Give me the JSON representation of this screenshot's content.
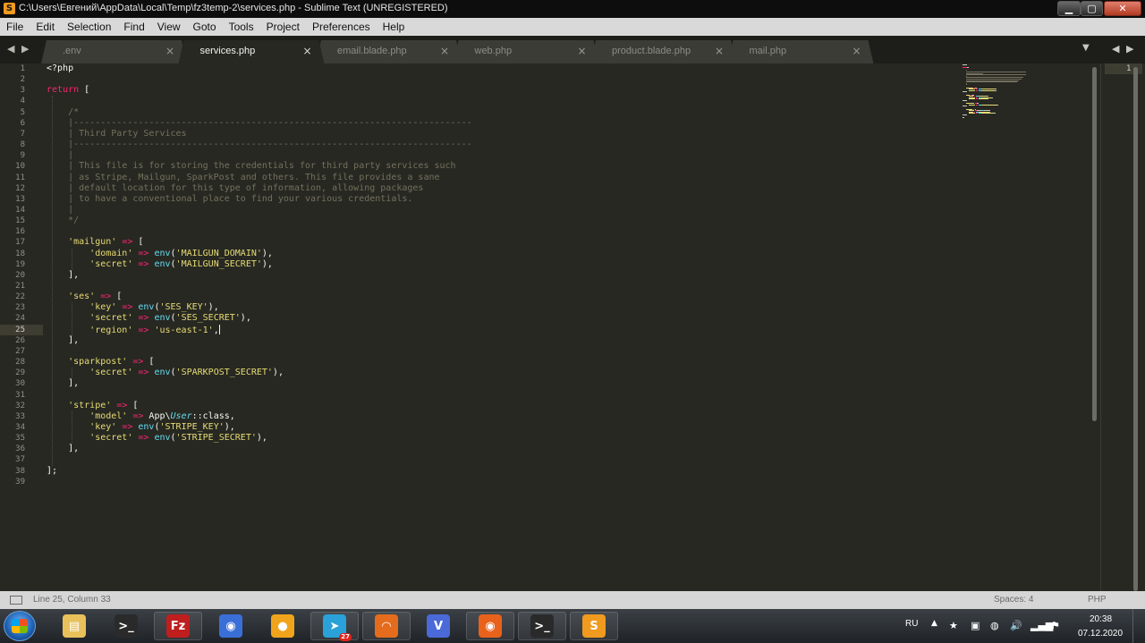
{
  "window": {
    "title": "C:\\Users\\Евгений\\AppData\\Local\\Temp\\fz3temp-2\\services.php - Sublime Text (UNREGISTERED)",
    "buttons": {
      "minimize": "▁",
      "maximize": "▢",
      "close": "✕"
    }
  },
  "menu": [
    "File",
    "Edit",
    "Selection",
    "Find",
    "View",
    "Goto",
    "Tools",
    "Project",
    "Preferences",
    "Help"
  ],
  "tabs": [
    {
      "label": ".env",
      "active": false
    },
    {
      "label": "services.php",
      "active": true
    },
    {
      "label": "email.blade.php",
      "active": false
    },
    {
      "label": "web.php",
      "active": false
    },
    {
      "label": "product.blade.php",
      "active": false
    },
    {
      "label": "mail.php",
      "active": false
    }
  ],
  "tab_close_glyph": "×",
  "tab_nav_glyph": "◀ ▶",
  "tab_dropdown_glyph": "▼",
  "code": [
    [
      [
        "",
        "<?php"
      ]
    ],
    [],
    [
      [
        "kw",
        "return"
      ],
      [
        "",
        " ["
      ]
    ],
    [],
    [
      [
        "",
        "    "
      ],
      [
        "cm",
        "/*"
      ]
    ],
    [
      [
        "",
        "    "
      ],
      [
        "cm",
        "|--------------------------------------------------------------------------"
      ]
    ],
    [
      [
        "",
        "    "
      ],
      [
        "cm",
        "| Third Party Services"
      ]
    ],
    [
      [
        "",
        "    "
      ],
      [
        "cm",
        "|--------------------------------------------------------------------------"
      ]
    ],
    [
      [
        "",
        "    "
      ],
      [
        "cm",
        "|"
      ]
    ],
    [
      [
        "",
        "    "
      ],
      [
        "cm",
        "| This file is for storing the credentials for third party services such"
      ]
    ],
    [
      [
        "",
        "    "
      ],
      [
        "cm",
        "| as Stripe, Mailgun, SparkPost and others. This file provides a sane"
      ]
    ],
    [
      [
        "",
        "    "
      ],
      [
        "cm",
        "| default location for this type of information, allowing packages"
      ]
    ],
    [
      [
        "",
        "    "
      ],
      [
        "cm",
        "| to have a conventional place to find your various credentials."
      ]
    ],
    [
      [
        "",
        "    "
      ],
      [
        "cm",
        "|"
      ]
    ],
    [
      [
        "",
        "    "
      ],
      [
        "cm",
        "*/"
      ]
    ],
    [],
    [
      [
        "",
        "    "
      ],
      [
        "str",
        "'mailgun'"
      ],
      [
        "",
        " "
      ],
      [
        "op",
        "=>"
      ],
      [
        "",
        " ["
      ]
    ],
    [
      [
        "",
        "        "
      ],
      [
        "str",
        "'domain'"
      ],
      [
        "",
        " "
      ],
      [
        "op",
        "=>"
      ],
      [
        "",
        " "
      ],
      [
        "fn",
        "env"
      ],
      [
        "",
        "("
      ],
      [
        "str",
        "'MAILGUN_DOMAIN'"
      ],
      [
        "",
        "),"
      ]
    ],
    [
      [
        "",
        "        "
      ],
      [
        "str",
        "'secret'"
      ],
      [
        "",
        " "
      ],
      [
        "op",
        "=>"
      ],
      [
        "",
        " "
      ],
      [
        "fn",
        "env"
      ],
      [
        "",
        "("
      ],
      [
        "str",
        "'MAILGUN_SECRET'"
      ],
      [
        "",
        "),"
      ]
    ],
    [
      [
        "",
        "    ],"
      ]
    ],
    [],
    [
      [
        "",
        "    "
      ],
      [
        "str",
        "'ses'"
      ],
      [
        "",
        " "
      ],
      [
        "op",
        "=>"
      ],
      [
        "",
        " ["
      ]
    ],
    [
      [
        "",
        "        "
      ],
      [
        "str",
        "'key'"
      ],
      [
        "",
        " "
      ],
      [
        "op",
        "=>"
      ],
      [
        "",
        " "
      ],
      [
        "fn",
        "env"
      ],
      [
        "",
        "("
      ],
      [
        "str",
        "'SES_KEY'"
      ],
      [
        "",
        "),"
      ]
    ],
    [
      [
        "",
        "        "
      ],
      [
        "str",
        "'secret'"
      ],
      [
        "",
        " "
      ],
      [
        "op",
        "=>"
      ],
      [
        "",
        " "
      ],
      [
        "fn",
        "env"
      ],
      [
        "",
        "("
      ],
      [
        "str",
        "'SES_SECRET'"
      ],
      [
        "",
        "),"
      ]
    ],
    [
      [
        "",
        "        "
      ],
      [
        "str",
        "'region'"
      ],
      [
        "",
        " "
      ],
      [
        "op",
        "=>"
      ],
      [
        "",
        " "
      ],
      [
        "str",
        "'us-east-1'"
      ],
      [
        "",
        ","
      ]
    ],
    [
      [
        "",
        "    ],"
      ]
    ],
    [],
    [
      [
        "",
        "    "
      ],
      [
        "str",
        "'sparkpost'"
      ],
      [
        "",
        " "
      ],
      [
        "op",
        "=>"
      ],
      [
        "",
        " ["
      ]
    ],
    [
      [
        "",
        "        "
      ],
      [
        "str",
        "'secret'"
      ],
      [
        "",
        " "
      ],
      [
        "op",
        "=>"
      ],
      [
        "",
        " "
      ],
      [
        "fn",
        "env"
      ],
      [
        "",
        "("
      ],
      [
        "str",
        "'SPARKPOST_SECRET'"
      ],
      [
        "",
        "),"
      ]
    ],
    [
      [
        "",
        "    ],"
      ]
    ],
    [],
    [
      [
        "",
        "    "
      ],
      [
        "str",
        "'stripe'"
      ],
      [
        "",
        " "
      ],
      [
        "op",
        "=>"
      ],
      [
        "",
        " ["
      ]
    ],
    [
      [
        "",
        "        "
      ],
      [
        "str",
        "'model'"
      ],
      [
        "",
        " "
      ],
      [
        "op",
        "=>"
      ],
      [
        "",
        " App\\"
      ],
      [
        "it",
        "User"
      ],
      [
        "",
        "::class,"
      ]
    ],
    [
      [
        "",
        "        "
      ],
      [
        "str",
        "'key'"
      ],
      [
        "",
        " "
      ],
      [
        "op",
        "=>"
      ],
      [
        "",
        " "
      ],
      [
        "fn",
        "env"
      ],
      [
        "",
        "("
      ],
      [
        "str",
        "'STRIPE_KEY'"
      ],
      [
        "",
        "),"
      ]
    ],
    [
      [
        "",
        "        "
      ],
      [
        "str",
        "'secret'"
      ],
      [
        "",
        " "
      ],
      [
        "op",
        "=>"
      ],
      [
        "",
        " "
      ],
      [
        "fn",
        "env"
      ],
      [
        "",
        "("
      ],
      [
        "str",
        "'STRIPE_SECRET'"
      ],
      [
        "",
        "),"
      ]
    ],
    [
      [
        "",
        "    ],"
      ]
    ],
    [],
    [
      [
        "",
        "];"
      ]
    ],
    []
  ],
  "cursor": {
    "line": 25,
    "column": 33
  },
  "pane2": {
    "line_number": "1"
  },
  "status": {
    "position": "Line 25, Column 33",
    "spaces": "Spaces: 4",
    "syntax": "PHP"
  },
  "taskbar": {
    "apps": [
      {
        "name": "file-explorer",
        "glyph": "▤",
        "color": "#e8c15a",
        "running": false
      },
      {
        "name": "terminal",
        "glyph": ">_",
        "color": "#2a2a2a",
        "running": false
      },
      {
        "name": "filezilla",
        "glyph": "Fz",
        "color": "#bf1e1e",
        "running": true
      },
      {
        "name": "firefox-dev",
        "glyph": "◉",
        "color": "#3b6fd8",
        "running": false
      },
      {
        "name": "chrome-like",
        "glyph": "●",
        "color": "#f0a41c",
        "running": false
      },
      {
        "name": "telegram",
        "glyph": "➤",
        "color": "#2aa1d8",
        "running": true,
        "badge": "27"
      },
      {
        "name": "postman",
        "glyph": "◠",
        "color": "#e46c1c",
        "running": true
      },
      {
        "name": "vue-tool",
        "glyph": "V",
        "color": "#4a6ad8",
        "running": false
      },
      {
        "name": "firefox",
        "glyph": "◉",
        "color": "#e8621c",
        "running": true
      },
      {
        "name": "console",
        "glyph": ">_",
        "color": "#2a2a2a",
        "running": true
      },
      {
        "name": "sublime-text",
        "glyph": "S",
        "color": "#f09a1f",
        "running": true
      }
    ],
    "tray": {
      "language": "RU",
      "arrow": "▲",
      "icons": [
        "★",
        "▣",
        "◍",
        "🔊",
        "▂▄▆",
        "⚑"
      ],
      "time": "20:38",
      "date": "07.12.2020"
    }
  }
}
